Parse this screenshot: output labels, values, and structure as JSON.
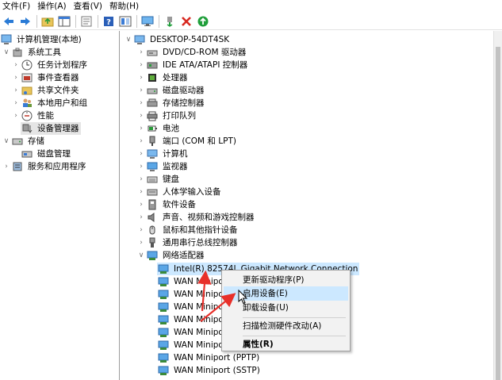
{
  "menu": [
    "文件(F)",
    "操作(A)",
    "查看(V)",
    "帮助(H)"
  ],
  "left_tree": {
    "root": "计算机管理(本地)",
    "system_tools": "系统工具",
    "items": [
      "任务计划程序",
      "事件查看器",
      "共享文件夹",
      "本地用户和组",
      "性能",
      "设备管理器"
    ],
    "storage": "存储",
    "disk_mgmt": "磁盘管理",
    "services": "服务和应用程序"
  },
  "device_tree": {
    "computer": "DESKTOP-54DT4SK",
    "categories": [
      "DVD/CD-ROM 驱动器",
      "IDE ATA/ATAPI 控制器",
      "处理器",
      "磁盘驱动器",
      "存储控制器",
      "打印队列",
      "电池",
      "端口 (COM 和 LPT)",
      "计算机",
      "监视器",
      "键盘",
      "人体学输入设备",
      "软件设备",
      "声音、视频和游戏控制器",
      "鼠标和其他指针设备",
      "通用串行总线控制器"
    ],
    "network": "网络适配器",
    "network_devices": [
      "Intel(R) 82574L Gigabit Network Connection",
      "WAN Minipo",
      "WAN Minipo",
      "WAN Minipo",
      "WAN Minipo",
      "WAN Minipo",
      "WAN Minipo",
      "WAN Miniport (PPTP)",
      "WAN Miniport (SSTP)"
    ]
  },
  "context_menu": {
    "update_driver": "更新驱动程序(P)",
    "enable_device": "启用设备(E)",
    "uninstall": "卸载设备(U)",
    "scan": "扫描检测硬件改动(A)",
    "properties": "属性(R)"
  },
  "colors": {
    "annotation_arrow": "#e8302a",
    "selection": "#cce8ff",
    "green_action": "#1f9e3a",
    "red_action": "#d7281f"
  }
}
